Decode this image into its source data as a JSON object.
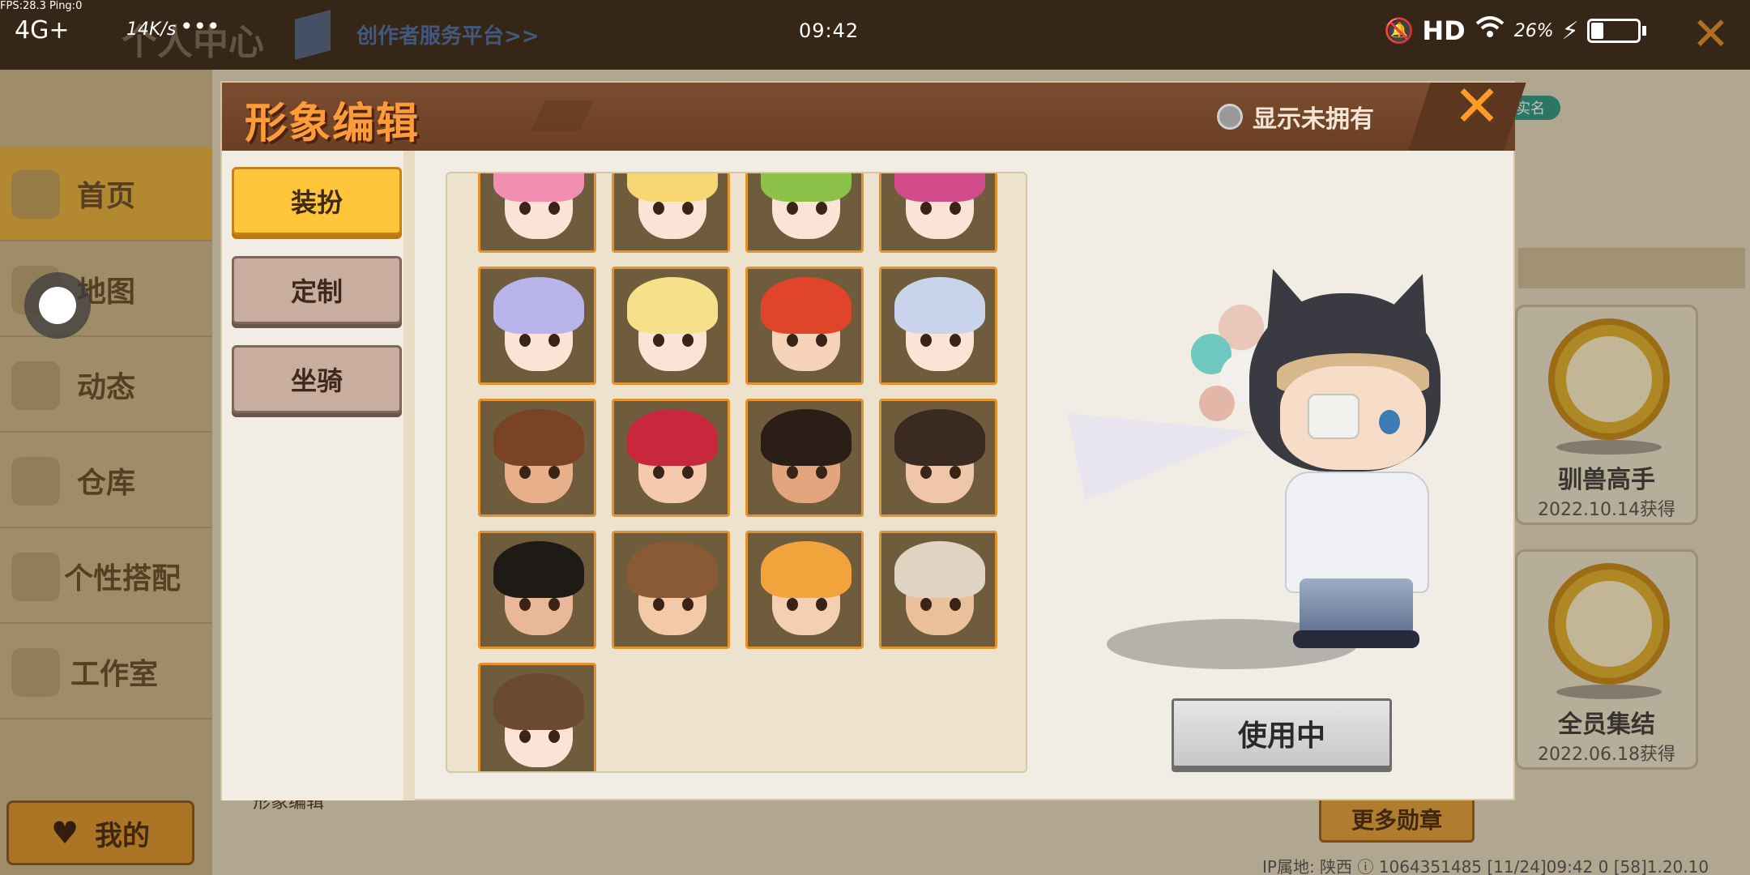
{
  "status_bar": {
    "fps": "FPS:28.3  Ping:0",
    "signal": "4G+",
    "speed": "14K/s",
    "dots": "•••",
    "clock": "09:42",
    "hd": "HD",
    "battery_pct": "26%",
    "battery_level": 0.26
  },
  "background": {
    "title": "个人中心",
    "creator_link": "创作者服务平台>>",
    "nav": [
      "首页",
      "地图",
      "动态",
      "仓库",
      "个性搭配",
      "工作室"
    ],
    "me_label": "我的",
    "realname_badge": "实名",
    "section_label": "形象编辑",
    "medals": [
      {
        "name": "驯兽高手",
        "date": "2022.10.14获得"
      },
      {
        "name": "全员集结",
        "date": "2022.06.18获得"
      }
    ],
    "more_medals": "更多勋章",
    "ip_info": "IP属地: 陕西 ⓘ    1064351485    [11/24]09:42 0  [58]1.20.10"
  },
  "modal": {
    "title": "形象编辑",
    "show_unowned_label": "显示未拥有",
    "close_icon": "close-icon",
    "tabs": [
      {
        "label": "装扮",
        "active": true
      },
      {
        "label": "定制",
        "active": false
      },
      {
        "label": "坐骑",
        "active": false
      }
    ],
    "avatars": [
      {
        "hair": "#f28fb0",
        "face": "#fbe3d6"
      },
      {
        "hair": "#f7d774",
        "face": "#fbe3d6"
      },
      {
        "hair": "#8cc24a",
        "face": "#fbe3d6"
      },
      {
        "hair": "#d14a8a",
        "face": "#fbe3d6"
      },
      {
        "hair": "#b9b4ec",
        "face": "#fbe3d6"
      },
      {
        "hair": "#f6e08a",
        "face": "#fbe3d6"
      },
      {
        "hair": "#e0452c",
        "face": "#f6d2b8"
      },
      {
        "hair": "#c9d3ec",
        "face": "#fbe3d6"
      },
      {
        "hair": "#7a4326",
        "face": "#e7b08a"
      },
      {
        "hair": "#c8283c",
        "face": "#f4c9ae"
      },
      {
        "hair": "#2b1e16",
        "face": "#e2a57e"
      },
      {
        "hair": "#3a2a22",
        "face": "#f0c6a8"
      },
      {
        "hair": "#1e1a16",
        "face": "#e8b898"
      },
      {
        "hair": "#8a5a34",
        "face": "#f3c9a8"
      },
      {
        "hair": "#f2a43c",
        "face": "#f4cfb2"
      },
      {
        "hair": "#e0d4c2",
        "face": "#eac09a"
      },
      {
        "hair": "#6b4a30",
        "face": "#fbe3d6"
      }
    ],
    "use_button": "使用中"
  }
}
